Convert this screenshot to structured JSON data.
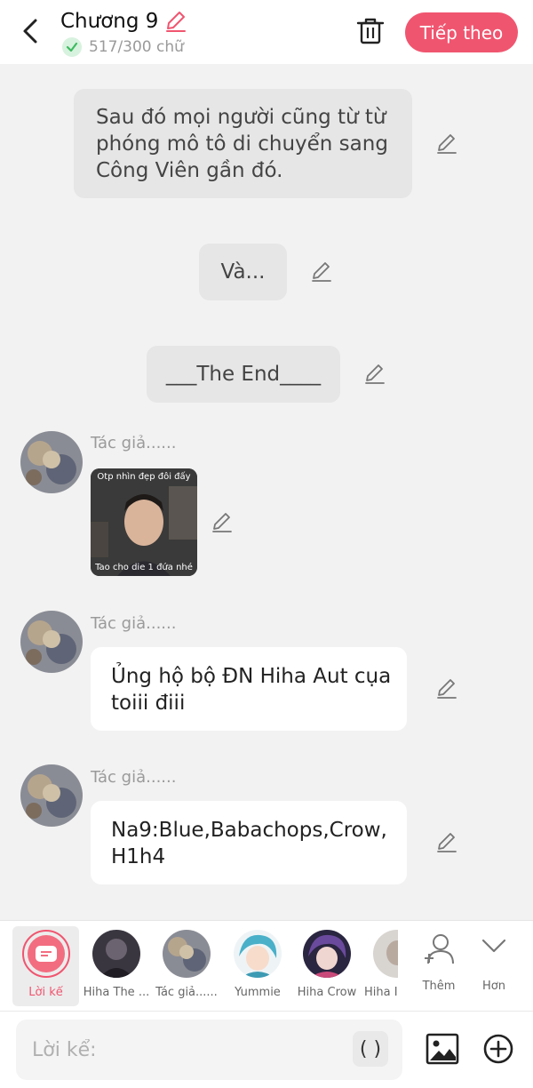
{
  "header": {
    "title": "Chương 9",
    "word_count": "517/300 chữ",
    "next_label": "Tiếp theo",
    "accent_color": "#f0556f"
  },
  "messages": [
    {
      "kind": "narration",
      "text_lines": [
        "Sau đó mọi người cũng từ từ",
        "phóng mô tô di chuyển sang",
        "Công Viên gần đó."
      ]
    },
    {
      "kind": "narration",
      "text": "Và..."
    },
    {
      "kind": "narration",
      "text": "___The End____"
    },
    {
      "kind": "image",
      "author": "Tác giả......",
      "image_caption_top": "Otp nhìn đẹp đôi đấy",
      "image_caption_bottom": "Tao cho die 1 đứa nhé"
    },
    {
      "kind": "chat",
      "author": "Tác giả......",
      "text_lines": [
        "Ủng hộ bộ ĐN Hiha Aut cụa",
        "toiii điii"
      ]
    },
    {
      "kind": "chat",
      "author": "Tác giả......",
      "text_lines": [
        "Na9:Blue,Babachops,Crow,",
        "H1h4"
      ]
    }
  ],
  "characters": [
    {
      "label": "Lời kể",
      "icon": "narration-icon",
      "selected": true
    },
    {
      "label": "Hiha The ...",
      "icon": "avatar"
    },
    {
      "label": "Tác giả......",
      "icon": "avatar"
    },
    {
      "label": "Yummie",
      "icon": "avatar"
    },
    {
      "label": "Hiha Crow",
      "icon": "avatar"
    },
    {
      "label": "Hiha I",
      "icon": "avatar"
    },
    {
      "label": "Thêm",
      "icon": "add-person-icon"
    },
    {
      "label": "Hơn",
      "icon": "chevron-down-icon"
    }
  ],
  "input": {
    "placeholder": "Lời kể:",
    "paren_label": "( )"
  }
}
